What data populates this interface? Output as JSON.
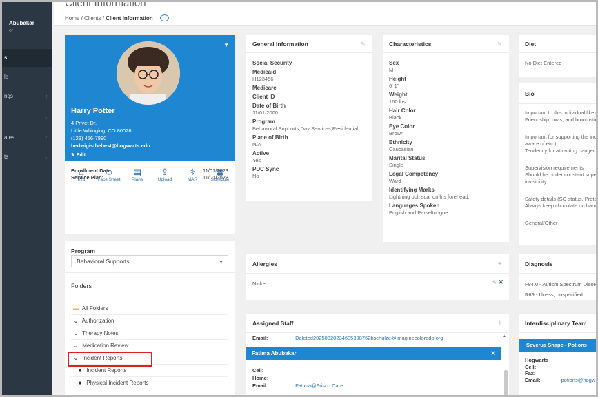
{
  "sidebar": {
    "user_name": "Abubakar",
    "user_role": "or",
    "items": [
      {
        "label": "s",
        "chevron": ""
      },
      {
        "label": "le",
        "chevron": ""
      },
      {
        "label": "ngs",
        "chevron": "‹"
      },
      {
        "label": "",
        "chevron": "‹"
      },
      {
        "label": "ates",
        "chevron": "‹"
      },
      {
        "label": "ts",
        "chevron": "‹"
      }
    ]
  },
  "header": {
    "title": "Client Information",
    "breadcrumb": {
      "home": "Home",
      "sep": "/",
      "clients": "Clients",
      "current": "Client Information"
    }
  },
  "profile": {
    "name": "Harry Potter",
    "address1": "4 Privet Dr.",
    "address2": "Little Whinging, CO 80026",
    "phone": "(123) 456-7890",
    "email": "hedwigisthebest@hogwarts.edu",
    "edit_label": "Edit",
    "enrollment_label": "Enrollment Date:",
    "enrollment_value": "11/01/2023",
    "service_label": "Service Plan:",
    "service_value": "11/01/2023",
    "quick_actions": [
      {
        "label": "Info",
        "icon": "home-icon",
        "glyph": "⌂"
      },
      {
        "label": "Face Sheet",
        "icon": "face-sheet-icon",
        "glyph": "☺"
      },
      {
        "label": "Plans",
        "icon": "plans-icon",
        "glyph": "▤"
      },
      {
        "label": "Upload",
        "icon": "upload-icon",
        "glyph": "⇪"
      },
      {
        "label": "MAR",
        "icon": "mar-icon",
        "glyph": "⚕"
      },
      {
        "label": "Schedule",
        "icon": "calendar-icon",
        "glyph": "▦"
      }
    ]
  },
  "program": {
    "label": "Program",
    "selected": "Behavioral Supports"
  },
  "folders": {
    "title": "Folders",
    "items": [
      {
        "label": "All Folders",
        "icon": "folder-open-icon",
        "glyph": "▬"
      },
      {
        "label": "Authorization",
        "icon": "chevron-down-icon",
        "glyph": "⌄"
      },
      {
        "label": "Therapy Notes",
        "icon": "chevron-down-icon",
        "glyph": "⌄"
      },
      {
        "label": "Medication Review",
        "icon": "chevron-down-icon",
        "glyph": "⌄"
      },
      {
        "label": "Incident Reports",
        "icon": "chevron-down-icon",
        "glyph": "⌄"
      },
      {
        "label": "Incident Reports",
        "icon": "folder-icon",
        "glyph": "■"
      },
      {
        "label": "Physical Incident Reports",
        "icon": "folder-icon",
        "glyph": "■"
      }
    ]
  },
  "general": {
    "title": "General Information",
    "fields": [
      {
        "k": "Social Security",
        "v": ""
      },
      {
        "k": "Medicaid",
        "v": "H123456"
      },
      {
        "k": "Medicare",
        "v": ""
      },
      {
        "k": "Client ID",
        "v": ""
      },
      {
        "k": "Date of Birth",
        "v": "11/01/2000"
      },
      {
        "k": "Program",
        "v": "Behavioral Supports,Day Services,Residential"
      },
      {
        "k": "Place of Birth",
        "v": "N/A"
      },
      {
        "k": "Active",
        "v": "Yes"
      },
      {
        "k": "PDC Sync",
        "v": "No"
      }
    ]
  },
  "characteristics": {
    "title": "Characteristics",
    "fields": [
      {
        "k": "Sex",
        "v": "M"
      },
      {
        "k": "Height",
        "v": "6' 1\""
      },
      {
        "k": "Weight",
        "v": "160 lbs"
      },
      {
        "k": "Hair Color",
        "v": "Black"
      },
      {
        "k": "Eye Color",
        "v": "Brown"
      },
      {
        "k": "Ethnicity",
        "v": "Caucasian"
      },
      {
        "k": "Marital Status",
        "v": "Single"
      },
      {
        "k": "Legal Competency",
        "v": "Ward"
      },
      {
        "k": "Identifying Marks",
        "v": "Lightning bolt scar on his forehead."
      },
      {
        "k": "Languages Spoken",
        "v": "English and Parseltongue"
      }
    ]
  },
  "diet": {
    "title": "Diet",
    "value": "No Diet Entered"
  },
  "bio": {
    "title": "Bio",
    "rows": [
      {
        "l1": "Important to this individual likes,",
        "l2": "Friendship, owls, and broomstic"
      },
      {
        "l1": "Important for supporting the indi",
        "l2": "aware of etc.)",
        "l3": "Tendency for attracting danger a"
      },
      {
        "l1": "Supervision requirements",
        "l2": "Should be under constant super",
        "l3": "invisibility."
      },
      {
        "l1": "Safety details (SO status, Protoc",
        "l2": "Always keep chocolate on hand"
      },
      {
        "l1": "General/Other"
      }
    ]
  },
  "allergies": {
    "title": "Allergies",
    "value": "Nickel"
  },
  "diagnosis": {
    "title": "Diagnosis",
    "items": [
      "F84.0 - Autism Spectrum Disord",
      "R69 - Illness, unspecified"
    ]
  },
  "staff": {
    "title": "Assigned Staff",
    "email_label": "Email:",
    "email_value": "Deleted20250320234605398762bschulze@imaginecolorado.org",
    "selected_name": "Fatima Abubakar",
    "cell_label": "Cell:",
    "home_label": "Home:",
    "email2_label": "Email:",
    "email2_value": "Fatima@Frisco Care"
  },
  "team": {
    "title": "Interdisciplinary Team",
    "member": "Severus Snape - Potions",
    "org": "Hogwarts",
    "cell_label": "Cell:",
    "fax_label": "Fax:",
    "email_label": "Email:",
    "email_value": "potions@hogw"
  },
  "colors": {
    "accent": "#1f86d1",
    "sidebar": "#2b3742",
    "highlight": "#e02020"
  }
}
